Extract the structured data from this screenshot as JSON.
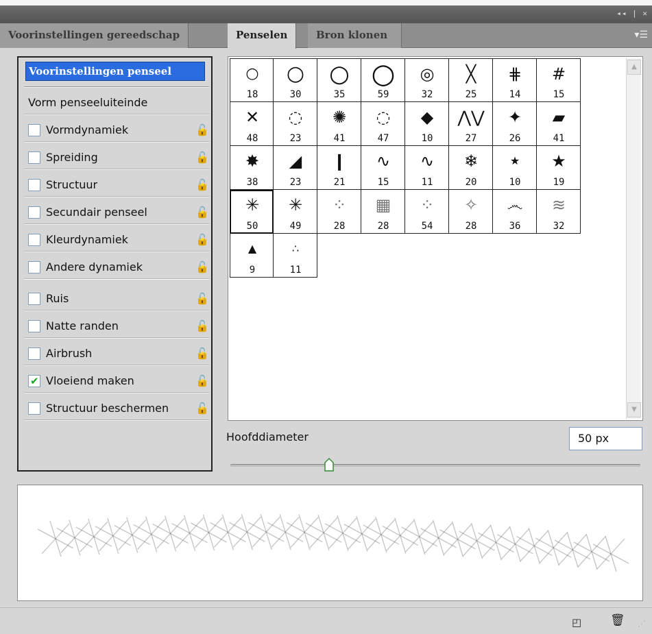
{
  "window": {
    "controls_text": "◂◂ | ✕"
  },
  "tabs": [
    {
      "label": "Voorinstellingen gereedschap"
    },
    {
      "label": "Penselen",
      "active": true
    },
    {
      "label": "Bron klonen"
    }
  ],
  "panel_menu_icon": "panel-menu-icon",
  "left_panel": {
    "preset_title": "Voorinstellingen penseel",
    "brush_tip_shape": "Vorm penseeluiteinde",
    "options": [
      {
        "label": "Vormdynamiek",
        "checked": false
      },
      {
        "label": "Spreiding",
        "checked": false
      },
      {
        "label": "Structuur",
        "checked": false
      },
      {
        "label": "Secundair penseel",
        "checked": false
      },
      {
        "label": "Kleurdynamiek",
        "checked": false
      },
      {
        "label": "Andere dynamiek",
        "checked": false
      },
      {
        "label": "Ruis",
        "checked": false
      },
      {
        "label": "Natte randen",
        "checked": false
      },
      {
        "label": "Airbrush",
        "checked": false
      },
      {
        "label": "Vloeiend maken",
        "checked": true
      },
      {
        "label": "Structuur beschermen",
        "checked": false
      }
    ]
  },
  "brushes": [
    {
      "size": "18",
      "icon": "hard-round-icon"
    },
    {
      "size": "30",
      "icon": "hard-round-icon"
    },
    {
      "size": "35",
      "icon": "hard-round-icon"
    },
    {
      "size": "59",
      "icon": "hard-round-icon"
    },
    {
      "size": "32",
      "icon": "double-ring-icon"
    },
    {
      "size": "25",
      "icon": "cross-icon"
    },
    {
      "size": "14",
      "icon": "hatch-icon"
    },
    {
      "size": "15",
      "icon": "grid-hatch-icon"
    },
    {
      "size": "48",
      "icon": "x-cross-icon"
    },
    {
      "size": "23",
      "icon": "dotted-ring-icon"
    },
    {
      "size": "41",
      "icon": "spiral-icon"
    },
    {
      "size": "47",
      "icon": "dotted-ring-icon"
    },
    {
      "size": "10",
      "icon": "diamond-icon"
    },
    {
      "size": "27",
      "icon": "zigzag-icon"
    },
    {
      "size": "26",
      "icon": "leaf-icon"
    },
    {
      "size": "41",
      "icon": "smudge-icon"
    },
    {
      "size": "38",
      "icon": "splatter-icon"
    },
    {
      "size": "23",
      "icon": "chalk-icon"
    },
    {
      "size": "21",
      "icon": "stroke-icon"
    },
    {
      "size": "15",
      "icon": "squiggle-icon"
    },
    {
      "size": "11",
      "icon": "squiggle-icon"
    },
    {
      "size": "20",
      "icon": "snowflake-icon"
    },
    {
      "size": "10",
      "icon": "star-icon"
    },
    {
      "size": "19",
      "icon": "star-icon"
    },
    {
      "size": "50",
      "icon": "starburst-icon",
      "selected": true
    },
    {
      "size": "49",
      "icon": "starburst-icon"
    },
    {
      "size": "28",
      "icon": "scatter-icon"
    },
    {
      "size": "28",
      "icon": "texture-icon"
    },
    {
      "size": "54",
      "icon": "scatter-icon"
    },
    {
      "size": "28",
      "icon": "fan-icon"
    },
    {
      "size": "36",
      "icon": "swirl-icon"
    },
    {
      "size": "32",
      "icon": "streak-icon"
    },
    {
      "size": "9",
      "icon": "triangle-icon"
    },
    {
      "size": "11",
      "icon": "three-dots-icon"
    }
  ],
  "diameter": {
    "label": "Hoofddiameter",
    "value": "50 px",
    "slider_fraction": 0.24
  },
  "footer": {
    "new_icon": "new-brush-icon",
    "trash_icon": "trash-icon"
  }
}
